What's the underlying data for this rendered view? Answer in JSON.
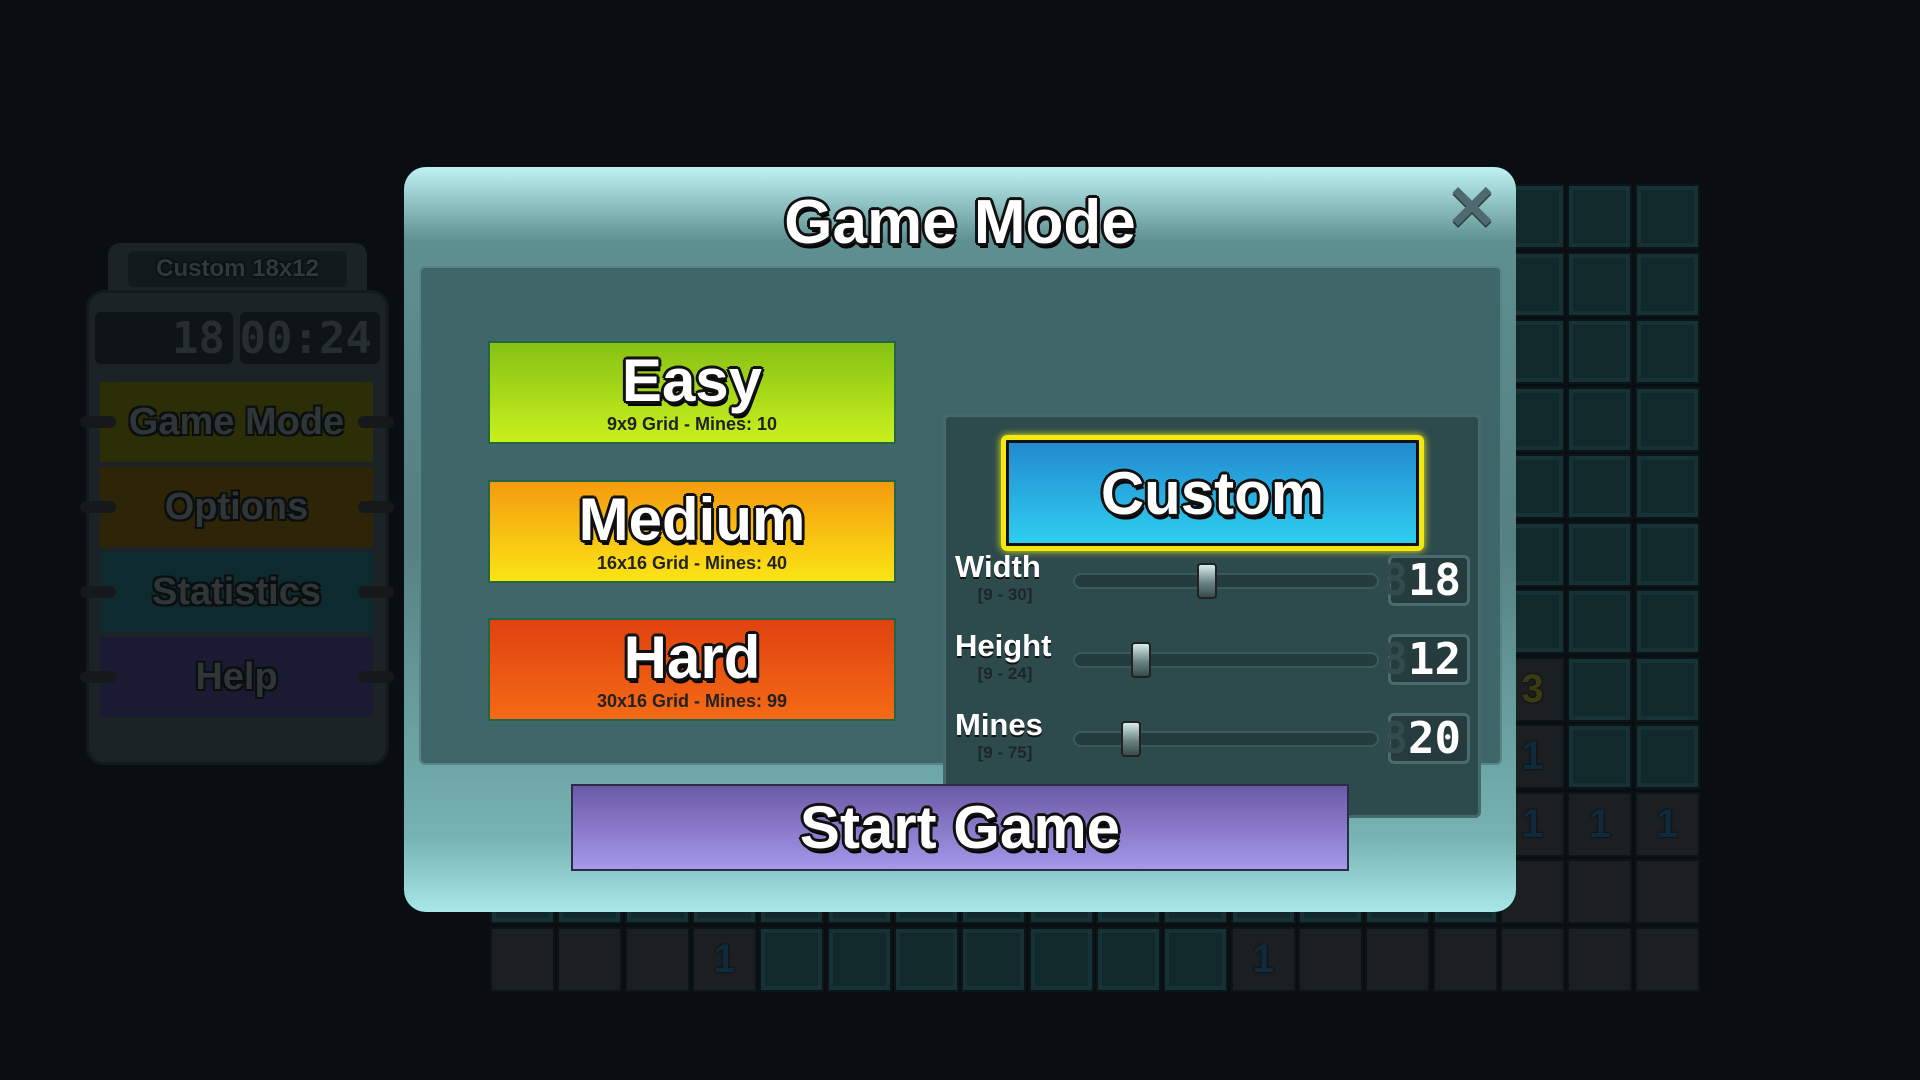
{
  "board": {
    "columns": 18,
    "rows": 12,
    "revealed": [
      [
        11,
        0
      ],
      [
        11,
        1
      ],
      [
        11,
        2
      ],
      [
        11,
        3
      ],
      [
        11,
        11
      ],
      [
        11,
        12
      ],
      [
        11,
        13
      ],
      [
        11,
        14
      ],
      [
        11,
        15
      ],
      [
        11,
        16
      ],
      [
        11,
        17
      ],
      [
        10,
        15
      ],
      [
        10,
        16
      ],
      [
        10,
        17
      ],
      [
        9,
        15
      ],
      [
        9,
        16
      ],
      [
        9,
        17
      ],
      [
        8,
        15
      ],
      [
        7,
        15
      ]
    ],
    "numbers": [
      {
        "r": 11,
        "c": 3,
        "v": "1"
      },
      {
        "r": 11,
        "c": 11,
        "v": "1"
      },
      {
        "r": 9,
        "c": 15,
        "v": "1"
      },
      {
        "r": 9,
        "c": 16,
        "v": "1"
      },
      {
        "r": 9,
        "c": 17,
        "v": "1"
      },
      {
        "r": 8,
        "c": 15,
        "v": "1"
      },
      {
        "r": 7,
        "c": 15,
        "v": "3"
      }
    ]
  },
  "side_panel": {
    "mode_tab": "Custom 18x12",
    "mine_counter": "18",
    "timer": "00:24",
    "buttons": [
      {
        "label": "Game Mode",
        "color": "#2c2e08"
      },
      {
        "label": "Options",
        "color": "#2e2407"
      },
      {
        "label": "Statistics",
        "color": "#0d2a2e"
      },
      {
        "label": "Help",
        "color": "#1b1a33"
      }
    ]
  },
  "modal": {
    "title": "Game Mode",
    "close_icon": "close-x-icon",
    "presets": [
      {
        "label": "Easy",
        "desc": "9x9 Grid - Mines: 10",
        "colors": [
          "#86c114",
          "#c9f01e"
        ]
      },
      {
        "label": "Medium",
        "desc": "16x16 Grid - Mines: 40",
        "colors": [
          "#f59a10",
          "#fbe514"
        ]
      },
      {
        "label": "Hard",
        "desc": "30x16 Grid - Mines: 99",
        "colors": [
          "#e0420f",
          "#f46a16"
        ]
      }
    ],
    "custom": {
      "label": "Custom",
      "selected": true,
      "sliders": [
        {
          "label": "Width",
          "range": "[9 - 30]",
          "min": 9,
          "max": 30,
          "value": 18,
          "display": "18"
        },
        {
          "label": "Height",
          "range": "[9 - 24]",
          "min": 9,
          "max": 24,
          "value": 12,
          "display": "12"
        },
        {
          "label": "Mines",
          "range": "[9 - 75]",
          "min": 9,
          "max": 75,
          "value": 20,
          "display": "20"
        }
      ]
    },
    "start_label": "Start Game"
  }
}
